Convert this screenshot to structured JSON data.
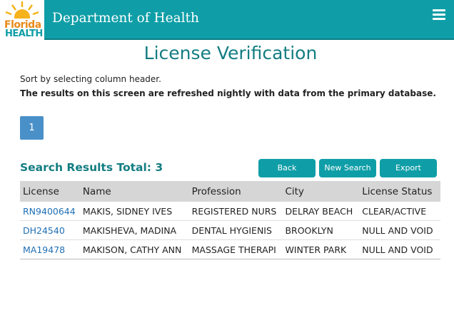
{
  "header": {
    "logo_line1": "Florida",
    "logo_line2": "HEALTH",
    "agency": "Department of Health",
    "menu_icon": "hamburger-menu-icon"
  },
  "page": {
    "title": "License Verification",
    "hint_sort": "Sort by selecting column header.",
    "hint_refresh": "The results on this screen are refreshed nightly with data from the primary database."
  },
  "pagination": {
    "current_page": "1"
  },
  "results": {
    "total_label": "Search Results Total: 3",
    "buttons": {
      "back": "Back",
      "new_search": "New Search",
      "export": "Export"
    },
    "columns": [
      "License",
      "Name",
      "Profession",
      "City",
      "License Status"
    ],
    "rows": [
      {
        "license": "RN9400644",
        "name": "MAKIS, SIDNEY IVES",
        "profession": "REGISTERED NURS",
        "city": "DELRAY BEACH",
        "status": "CLEAR/ACTIVE"
      },
      {
        "license": "DH24540",
        "name": "MAKISHEVA, MADINA",
        "profession": "DENTAL HYGIENIS",
        "city": "BROOKLYN",
        "status": "NULL AND VOID"
      },
      {
        "license": "MA19478",
        "name": "MAKISON, CATHY ANN",
        "profession": "MASSAGE THERAPI",
        "city": "WINTER PARK",
        "status": "NULL AND VOID"
      }
    ]
  },
  "colors": {
    "brand_teal": "#0f9ea7",
    "title_teal": "#137d82",
    "link_blue": "#1f6fb5",
    "pager_blue": "#4a90c8"
  }
}
